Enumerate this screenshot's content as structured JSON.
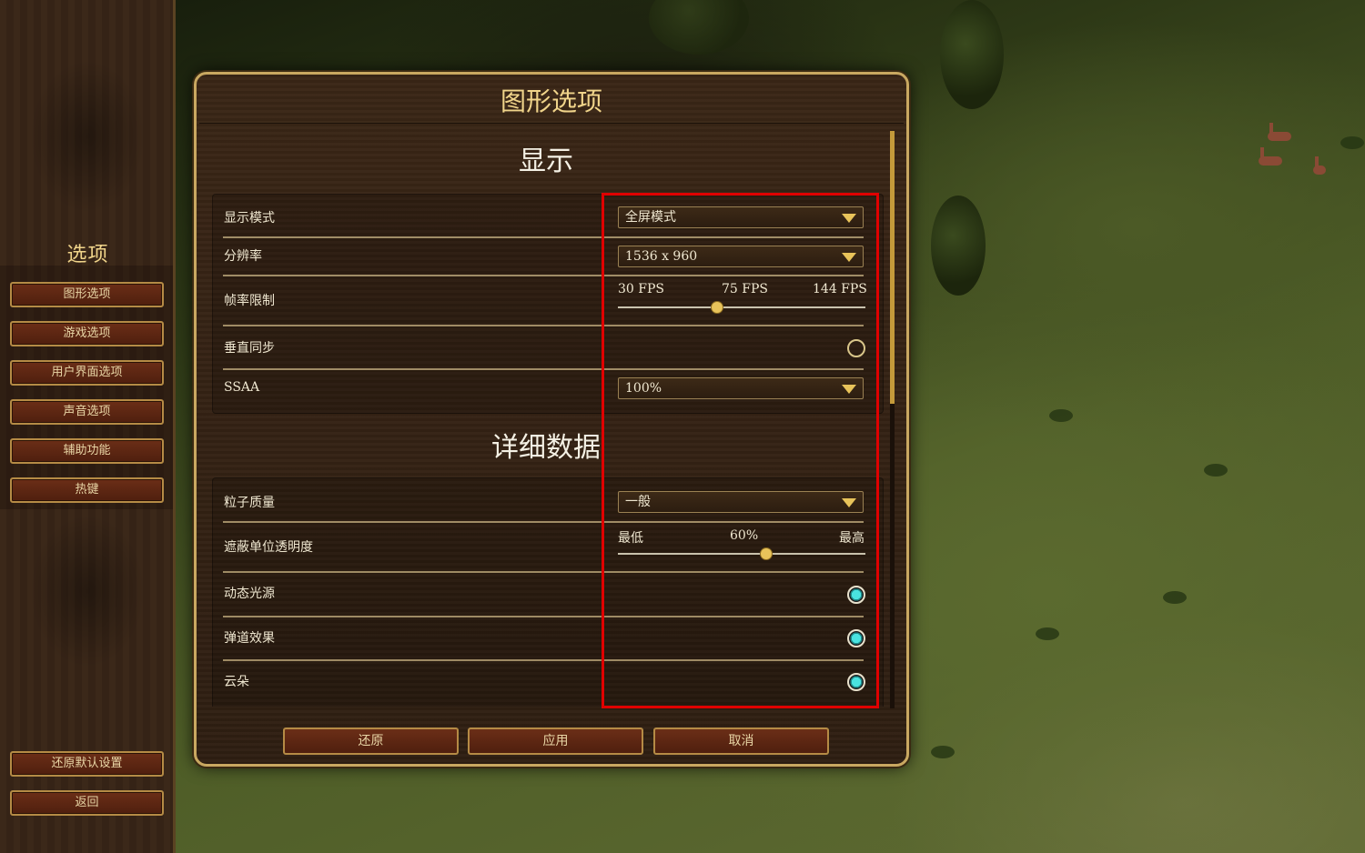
{
  "sidebar": {
    "title": "选项",
    "menu": [
      {
        "label": "图形选项"
      },
      {
        "label": "游戏选项"
      },
      {
        "label": "用户界面选项"
      },
      {
        "label": "声音选项"
      },
      {
        "label": "辅助功能"
      },
      {
        "label": "热键"
      }
    ],
    "restore_defaults_label": "还原默认设置",
    "back_label": "返回"
  },
  "dialog": {
    "title": "图形选项",
    "display_section": {
      "title": "显示",
      "display_mode": {
        "label": "显示模式",
        "value": "全屏模式"
      },
      "resolution": {
        "label": "分辨率",
        "value": "1536 x 960"
      },
      "frame_limit": {
        "label": "帧率限制",
        "min_label": "30 FPS",
        "current_label": "75 FPS",
        "max_label": "144 FPS",
        "position": 0.4
      },
      "vsync": {
        "label": "垂直同步",
        "checked": false
      },
      "ssaa": {
        "label": "SSAA",
        "value": "100%"
      }
    },
    "detail_section": {
      "title": "详细数据",
      "particle_quality": {
        "label": "粒子质量",
        "value": "一般"
      },
      "occluded_unit_opacity": {
        "label": "遮蔽单位透明度",
        "min_label": "最低",
        "current_label": "60%",
        "max_label": "最高",
        "position": 0.6
      },
      "dynamic_lights": {
        "label": "动态光源",
        "checked": true
      },
      "projectile_effects": {
        "label": "弹道效果",
        "checked": true
      },
      "clouds": {
        "label": "云朵",
        "checked": true
      }
    },
    "footer": {
      "revert_label": "还原",
      "apply_label": "应用",
      "cancel_label": "取消"
    }
  },
  "colors": {
    "accent_gold": "#f0d48a",
    "highlight_red": "#e00000",
    "radio_on": "#49e3e0"
  }
}
